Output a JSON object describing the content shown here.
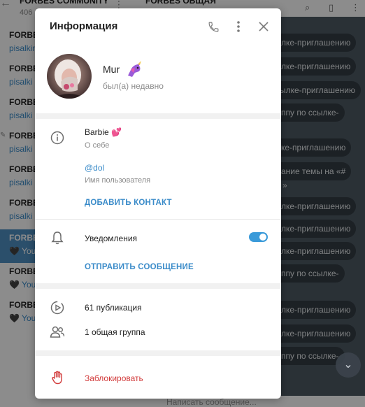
{
  "background": {
    "community": {
      "title": "FORBES COMMUNITY",
      "count": "406",
      "items": [
        {
          "title": "FORBES",
          "subtitle": "pisalkin"
        },
        {
          "title": "FORBES",
          "subtitle": "pisalki"
        },
        {
          "title": "FORBES",
          "subtitle": "pisalki"
        },
        {
          "title": "FORBES",
          "subtitle": "pisalki"
        },
        {
          "title": "FORBES",
          "subtitle": "pisalki"
        },
        {
          "title": "FORBES",
          "subtitle": "pisalki"
        },
        {
          "title": "FORBES",
          "subtitle": "🖤 You"
        },
        {
          "title": "FORBES",
          "subtitle": "🖤 You"
        },
        {
          "title": "FORBES",
          "subtitle": "🖤 You"
        }
      ]
    },
    "chat": {
      "title": "FORBES ОБЩАЯ",
      "bubbles": [
        "лке-приглашению",
        "лке-приглашению",
        "ылке-приглашению",
        "ппу по ссылке-",
        "ке-приглашению",
        "ание темы на «#",
        "»",
        "лке-приглашению",
        "лке-приглашению",
        "лке-приглашению",
        "ппу по ссылке-",
        "лке-приглашению",
        "лке-приглашению",
        "ппу по ссылке-"
      ],
      "compose_placeholder": "Написать сообщение..."
    }
  },
  "modal": {
    "title": "Информация",
    "profile": {
      "name": "Mur",
      "status": "был(а) недавно"
    },
    "about": {
      "value": "Barbie 💕",
      "label": "О себе"
    },
    "username": {
      "value": "@dol",
      "label": "Имя пользователя"
    },
    "add_contact_label": "ДОБАВИТЬ КОНТАКТ",
    "notifications": {
      "label": "Уведомления",
      "enabled": true
    },
    "send_message_label": "ОТПРАВИТЬ СООБЩЕНИЕ",
    "publications": "61 публикация",
    "groups": "1 общая группа",
    "block_label": "Заблокировать",
    "colors": {
      "accent": "#3a8bc9",
      "toggle": "#3a9ad9",
      "danger": "#d23b3b"
    }
  }
}
